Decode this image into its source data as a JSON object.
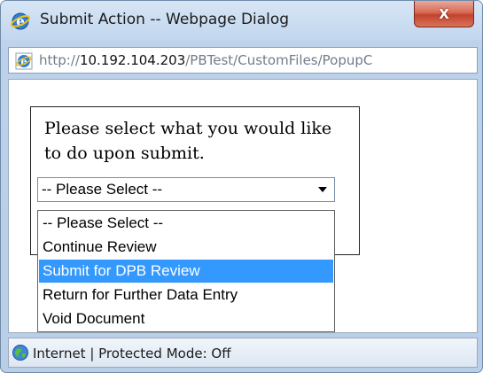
{
  "window": {
    "title": "Submit Action -- Webpage Dialog",
    "close_label": "X"
  },
  "address": {
    "proto": "http://",
    "host": "10.192.104.203",
    "path": "/PBTest/CustomFiles/PopupC"
  },
  "form": {
    "prompt": "Please select what you would like to do upon submit.",
    "select_value": "-- Please Select --",
    "options": [
      "-- Please Select --",
      "Continue Review",
      "Submit for DPB Review",
      "Return for Further Data Entry",
      "Void Document"
    ],
    "highlighted_option": "Submit for DPB Review"
  },
  "status": {
    "text": "Internet | Protected Mode: Off"
  },
  "icons": {
    "title": "ie-icon",
    "address": "ie-icon",
    "status": "globe-icon",
    "close": "close-icon",
    "dropdown": "chevron-down-icon"
  },
  "colors": {
    "frame": "#bcd1ea",
    "close_button": "#c2432c",
    "highlight": "#3399ff"
  }
}
